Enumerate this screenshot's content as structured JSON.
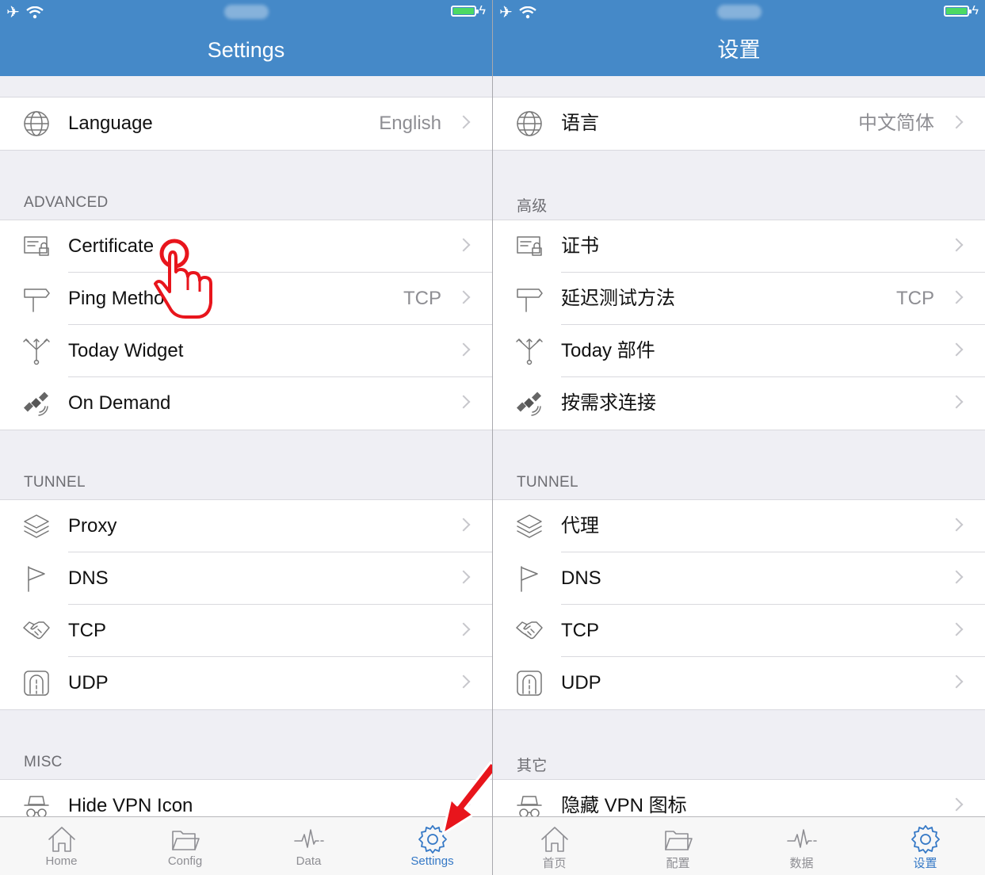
{
  "colors": {
    "header": "#4589c8",
    "accent": "#3478c6",
    "annotation": "#e8151c",
    "battery": "#4cd964"
  },
  "panels": [
    {
      "title": "Settings",
      "language": {
        "label": "Language",
        "value": "English",
        "icon": "globe-icon"
      },
      "advanced": {
        "header": "ADVANCED",
        "items": [
          {
            "label": "Certificate",
            "value": "",
            "icon": "certificate-icon"
          },
          {
            "label": "Ping Method",
            "value": "TCP",
            "icon": "signpost-icon"
          },
          {
            "label": "Today Widget",
            "value": "",
            "icon": "widget-icon"
          },
          {
            "label": "On Demand",
            "value": "",
            "icon": "satellite-icon"
          }
        ]
      },
      "tunnel": {
        "header": "TUNNEL",
        "items": [
          {
            "label": "Proxy",
            "icon": "layers-icon"
          },
          {
            "label": "DNS",
            "icon": "flag-icon"
          },
          {
            "label": "TCP",
            "icon": "handshake-icon"
          },
          {
            "label": "UDP",
            "icon": "tunnel-icon"
          }
        ]
      },
      "misc": {
        "header": "MISC",
        "items": [
          {
            "label": "Hide VPN Icon",
            "icon": "incognito-icon"
          }
        ]
      },
      "tabs": [
        {
          "label": "Home",
          "icon": "home-icon"
        },
        {
          "label": "Config",
          "icon": "folder-icon"
        },
        {
          "label": "Data",
          "icon": "pulse-icon"
        },
        {
          "label": "Settings",
          "icon": "gear-icon",
          "active": true
        }
      ]
    },
    {
      "title": "设置",
      "language": {
        "label": "语言",
        "value": "中文简体",
        "icon": "globe-icon"
      },
      "advanced": {
        "header": "高级",
        "items": [
          {
            "label": "证书",
            "value": "",
            "icon": "certificate-icon"
          },
          {
            "label": "延迟测试方法",
            "value": "TCP",
            "icon": "signpost-icon"
          },
          {
            "label": "Today 部件",
            "value": "",
            "icon": "widget-icon"
          },
          {
            "label": "按需求连接",
            "value": "",
            "icon": "satellite-icon"
          }
        ]
      },
      "tunnel": {
        "header": "TUNNEL",
        "items": [
          {
            "label": "代理",
            "icon": "layers-icon"
          },
          {
            "label": "DNS",
            "icon": "flag-icon"
          },
          {
            "label": "TCP",
            "icon": "handshake-icon"
          },
          {
            "label": "UDP",
            "icon": "tunnel-icon"
          }
        ]
      },
      "misc": {
        "header": "其它",
        "items": [
          {
            "label": "隐藏 VPN 图标",
            "icon": "incognito-icon"
          }
        ]
      },
      "tabs": [
        {
          "label": "首页",
          "icon": "home-icon"
        },
        {
          "label": "配置",
          "icon": "folder-icon"
        },
        {
          "label": "数据",
          "icon": "pulse-icon"
        },
        {
          "label": "设置",
          "icon": "gear-icon",
          "active": true
        }
      ]
    }
  ]
}
